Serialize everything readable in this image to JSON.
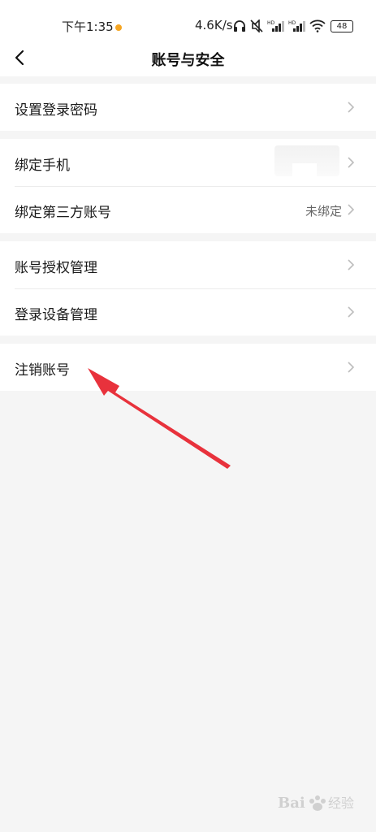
{
  "status_bar": {
    "time": "下午1:35",
    "net_speed": "4.6K/s",
    "battery": "48"
  },
  "nav": {
    "title": "账号与安全"
  },
  "groups": [
    {
      "rows": [
        {
          "label": "设置登录密码",
          "value": ""
        }
      ]
    },
    {
      "rows": [
        {
          "label": "绑定手机",
          "value": ""
        },
        {
          "label": "绑定第三方账号",
          "value": "未绑定"
        }
      ]
    },
    {
      "rows": [
        {
          "label": "账号授权管理",
          "value": ""
        },
        {
          "label": "登录设备管理",
          "value": ""
        }
      ]
    },
    {
      "rows": [
        {
          "label": "注销账号",
          "value": ""
        }
      ]
    }
  ],
  "colors": {
    "background": "#f5f5f5",
    "card": "#ffffff",
    "annotation_arrow": "#e8323c",
    "accent_dot": "#f6a623"
  },
  "watermark": {
    "brand": "Baidu",
    "label": "经验"
  }
}
